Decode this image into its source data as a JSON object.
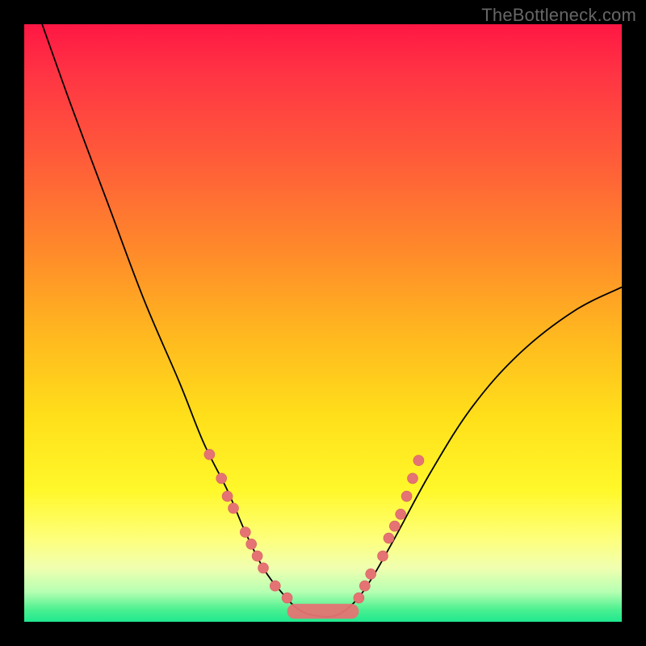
{
  "watermark": "TheBottleneck.com",
  "chart_data": {
    "type": "line",
    "title": "",
    "xlabel": "",
    "ylabel": "",
    "xlim": [
      0,
      100
    ],
    "ylim": [
      0,
      100
    ],
    "grid": false,
    "legend": false,
    "background_gradient": {
      "direction": "vertical",
      "stops": [
        {
          "pos": 0.0,
          "color": "#ff1744"
        },
        {
          "pos": 0.08,
          "color": "#ff3344"
        },
        {
          "pos": 0.22,
          "color": "#ff5a3a"
        },
        {
          "pos": 0.38,
          "color": "#ff8a2a"
        },
        {
          "pos": 0.52,
          "color": "#ffb81f"
        },
        {
          "pos": 0.66,
          "color": "#ffe01a"
        },
        {
          "pos": 0.78,
          "color": "#fff82a"
        },
        {
          "pos": 0.86,
          "color": "#feff7a"
        },
        {
          "pos": 0.91,
          "color": "#f0ffb0"
        },
        {
          "pos": 0.95,
          "color": "#b6ffb2"
        },
        {
          "pos": 0.98,
          "color": "#4af090"
        },
        {
          "pos": 1.0,
          "color": "#20e890"
        }
      ]
    },
    "series": [
      {
        "name": "bottleneck-curve",
        "color": "#000000",
        "x": [
          3,
          8,
          14,
          20,
          26,
          30,
          34,
          37,
          40,
          43,
          46,
          49,
          52,
          55,
          58,
          62,
          68,
          75,
          83,
          92,
          100
        ],
        "y": [
          100,
          86,
          70,
          54,
          40,
          30,
          22,
          15,
          9,
          5,
          2,
          1,
          1,
          3,
          7,
          14,
          25,
          36,
          45,
          52,
          56
        ]
      }
    ],
    "points": {
      "name": "sample-points",
      "color": "#e57373",
      "data": [
        {
          "x": 31,
          "y": 28
        },
        {
          "x": 33,
          "y": 24
        },
        {
          "x": 34,
          "y": 21
        },
        {
          "x": 35,
          "y": 19
        },
        {
          "x": 37,
          "y": 15
        },
        {
          "x": 38,
          "y": 13
        },
        {
          "x": 39,
          "y": 11
        },
        {
          "x": 40,
          "y": 9
        },
        {
          "x": 42,
          "y": 6
        },
        {
          "x": 44,
          "y": 4
        },
        {
          "x": 56,
          "y": 4
        },
        {
          "x": 57,
          "y": 6
        },
        {
          "x": 58,
          "y": 8
        },
        {
          "x": 60,
          "y": 11
        },
        {
          "x": 61,
          "y": 14
        },
        {
          "x": 62,
          "y": 16
        },
        {
          "x": 63,
          "y": 18
        },
        {
          "x": 64,
          "y": 21
        },
        {
          "x": 65,
          "y": 24
        },
        {
          "x": 66,
          "y": 27
        }
      ]
    },
    "ribbon": {
      "name": "bottom-band",
      "color": "#e57373",
      "x_range": [
        44,
        56
      ],
      "y_range": [
        0.5,
        3
      ]
    }
  }
}
